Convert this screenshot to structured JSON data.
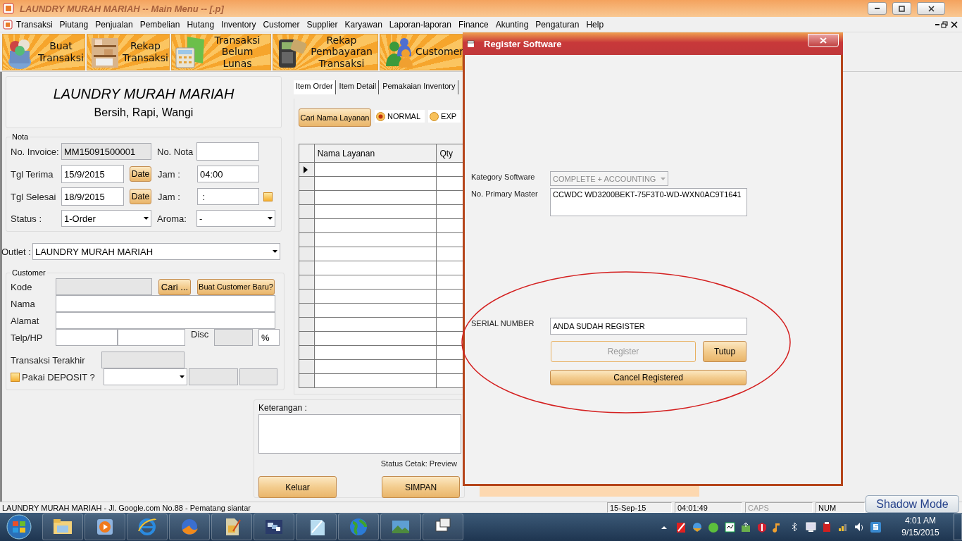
{
  "window": {
    "title": "LAUNDRY MURAH MARIAH  --  Main Menu  --  [.p]"
  },
  "menu": [
    "Transaksi",
    "Piutang",
    "Penjualan",
    "Pembelian",
    "Hutang",
    "Inventory",
    "Customer",
    "Supplier",
    "Karyawan",
    "Laporan-laporan",
    "Finance",
    "Akunting",
    "Pengaturan",
    "Help"
  ],
  "toolbar": [
    {
      "label": "Buat\nTransaksi",
      "kind": "basket"
    },
    {
      "label": "Rekap\nTransaksi",
      "kind": "shelf"
    },
    {
      "label": "Transaksi\nBelum Lunas",
      "kind": "calculator"
    },
    {
      "label": "Rekap\nPembayaran\nTransaksi",
      "kind": "terminal"
    },
    {
      "label": "Customer",
      "kind": "people"
    }
  ],
  "form": {
    "title": "LAUNDRY MURAH MARIAH",
    "subtitle": "Bersih, Rapi, Wangi",
    "nota": {
      "legend": "Nota",
      "invoice_label": "No. Invoice:",
      "invoice": "MM15091500001",
      "nota_label": "No. Nota",
      "terima_label": "Tgl Terima",
      "terima": "15/9/2015",
      "date_button": "Date",
      "jam_label": "Jam :",
      "jam_terima": "04:00",
      "selesai_label": "Tgl Selesai",
      "selesai": "18/9/2015",
      "date_button_2": "Date",
      "jam_label_2": "Jam :",
      "jam_selesai": " :",
      "jam_checked": false,
      "status_label": "Status :",
      "status": "1-Order",
      "aroma_label": "Aroma:",
      "aroma": "-"
    },
    "outlet_label": "Outlet :",
    "outlet": "LAUNDRY MURAH MARIAH",
    "customer": {
      "legend": "Customer",
      "kode_label": "Kode",
      "cari_button": "Cari ...",
      "new_button": "Buat Customer Baru?",
      "nama_label": "Nama",
      "alamat_label": "Alamat",
      "telp_label": "Telp/HP",
      "disc_label": "Disc",
      "percent": "%",
      "last_label": "Transaksi Terakhir",
      "deposit_label": "Pakai DEPOSIT ?",
      "deposit_checked": false
    }
  },
  "items": {
    "tabs": [
      {
        "label": "Item Order",
        "selected": true
      },
      {
        "label": "Item Detail",
        "selected": false
      },
      {
        "label": "Pemakaian Inventory",
        "selected": false
      }
    ],
    "search_button": "Cari Nama Layanan",
    "speed": [
      {
        "label": "NORMAL",
        "selected": true
      },
      {
        "label": "EXP",
        "selected": false
      }
    ],
    "columns": [
      "Nama Layanan",
      "Qty"
    ],
    "rows": [
      {
        "current": true
      },
      {
        "current": false
      },
      {
        "current": false
      },
      {
        "current": false
      },
      {
        "current": false
      },
      {
        "current": false
      },
      {
        "current": false
      },
      {
        "current": false
      },
      {
        "current": false
      },
      {
        "current": false
      },
      {
        "current": false
      },
      {
        "current": false
      },
      {
        "current": false
      },
      {
        "current": false
      },
      {
        "current": false
      },
      {
        "current": false
      }
    ]
  },
  "notes": {
    "label": "Keterangan :",
    "print_status": "Status Cetak: Preview",
    "buttons": [
      "Keluar",
      "SIMPAN"
    ]
  },
  "dialog": {
    "title": "Register Software",
    "category_label": "Kategory Software",
    "category": "COMPLETE + ACCOUNTING",
    "category_disabled": true,
    "master_label": "No. Primary Master",
    "master": "CCWDC WD3200BEKT-75F3T0-WD-WXN0AC9T1641",
    "serial_label": "SERIAL NUMBER",
    "serial": "ANDA SUDAH REGISTER",
    "buttons": [
      {
        "label": "Register",
        "disabled": true
      },
      {
        "label": "Tutup",
        "disabled": false
      },
      {
        "label": "Cancel Registered",
        "disabled": false
      }
    ]
  },
  "status_bar": {
    "text": "LAUNDRY MURAH MARIAH - Jl. Google.com No.88 - Pematang siantar",
    "date": "15-Sep-15",
    "time": "04:01:49",
    "indicators": [
      {
        "label": "CAPS",
        "on": false
      },
      {
        "label": "NUM",
        "on": true
      }
    ]
  },
  "shadow_button": "Shadow Mode",
  "clock": {
    "time": "4:01 AM",
    "date": "9/15/2015"
  }
}
